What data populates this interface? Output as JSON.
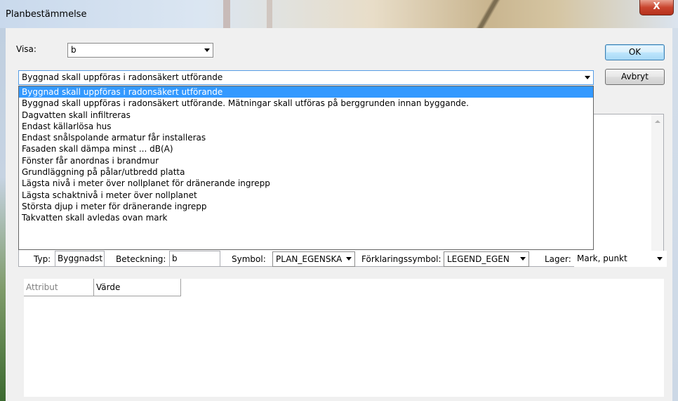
{
  "window": {
    "title": "Planbestämmelse",
    "close_glyph": "X"
  },
  "visa": {
    "label": "Visa:",
    "value": "b"
  },
  "bestammelse": {
    "selected": "Byggnad skall uppföras i radonsäkert utförande",
    "options": [
      "Byggnad skall uppföras i radonsäkert utförande",
      "Byggnad skall uppföras i radonsäkert utförande. Mätningar skall utföras på berggrunden innan byggande.",
      "Dagvatten skall infiltreras",
      "Endast källarlösa hus",
      "Endast snålspolande armatur får installeras",
      "Fasaden skall dämpa minst ... dB(A)",
      "Fönster får anordnas i brandmur",
      "Grundläggning på pålar/utbredd platta",
      "Lägsta nivå i meter över nollplanet för dränerande ingrepp",
      "Lägsta schaktnivå i meter över nollplanet",
      "Största djup i meter för dränerande ingrepp",
      "Takvatten skall avledas ovan mark"
    ]
  },
  "buttons": {
    "ok": "OK",
    "cancel": "Avbryt"
  },
  "fields": {
    "typ_label": "Typ:",
    "typ_value": "Byggnadst",
    "beteckning_label": "Beteckning:",
    "beteckning_value": "b",
    "symbol_label": "Symbol:",
    "symbol_value": "PLAN_EGENSKA",
    "forklaring_label": "Förklaringssymbol:",
    "forklaring_value": "LEGEND_EGEN",
    "lager_label": "Lager:",
    "lager_value": "Mark, punkt"
  },
  "grid": {
    "columns": [
      "Attribut",
      "Värde"
    ]
  },
  "icons": {
    "close": "close-icon",
    "dropdown": "chevron-down-icon",
    "scroll_up": "scroll-up-icon",
    "scroll_down": "scroll-down-icon"
  }
}
